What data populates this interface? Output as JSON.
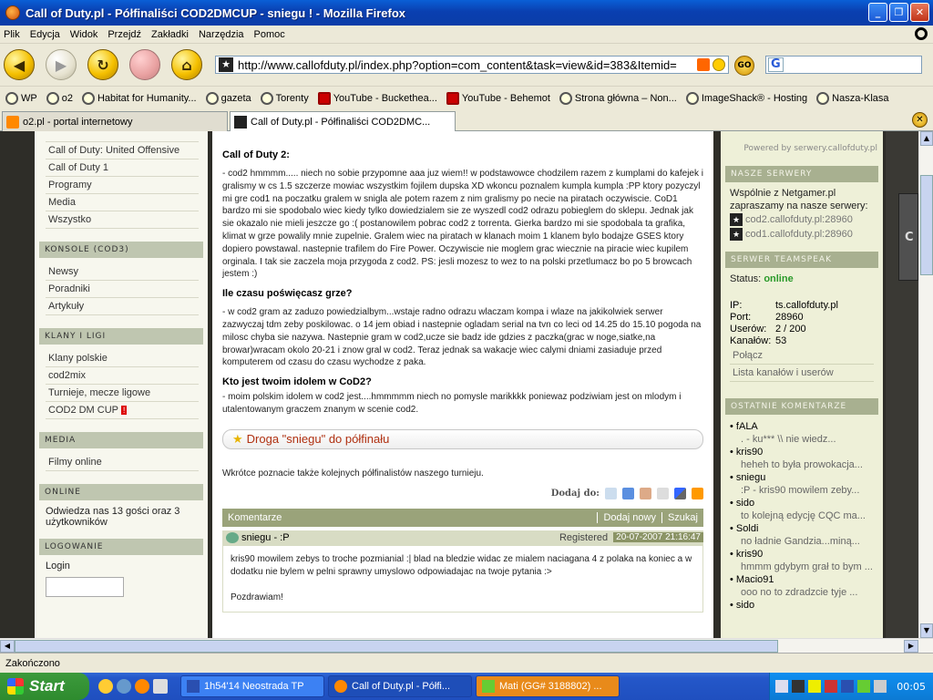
{
  "window": {
    "title": "Call of Duty.pl - Półfinaliści COD2DMCUP - sniegu ! - Mozilla Firefox"
  },
  "menu": [
    "Plik",
    "Edycja",
    "Widok",
    "Przejdź",
    "Zakładki",
    "Narzędzia",
    "Pomoc"
  ],
  "url": "http://www.callofduty.pl/index.php?option=com_content&task=view&id=383&Itemid=",
  "search_prefix": "G",
  "bookmarks": [
    "WP",
    "o2",
    "Habitat for Humanity...",
    "gazeta",
    "Torenty",
    "YouTube - Bucketheа...",
    "YouTube - Behemot",
    "Strona główna – Non...",
    "ImageShack® - Hosting",
    "Nasza-Klasa"
  ],
  "tabs": [
    {
      "label": "o2.pl - portal internetowy",
      "active": false
    },
    {
      "label": "Call of Duty.pl - Półfinaliści COD2DMC...",
      "active": true
    }
  ],
  "status": "Zakończono",
  "taskbar": {
    "start": "Start",
    "tasks": [
      "1h54'14 Neostrada TP",
      "Call of Duty.pl - Półfi...",
      "Mati (GG# 3188802) ..."
    ],
    "clock": "00:05"
  },
  "left": {
    "links_top": [
      "Call of Duty: United Offensive",
      "Call of Duty 1",
      "Programy",
      "Media",
      "Wszystko"
    ],
    "konsole": {
      "title": "KONSOLE (COD3)",
      "items": [
        "Newsy",
        "Poradniki",
        "Artykuły"
      ]
    },
    "klany": {
      "title": "KLANY I LIGI",
      "items": [
        "Klany polskie",
        "cod2mix",
        "Turnieje, mecze ligowe",
        "COD2 DM CUP"
      ]
    },
    "media": {
      "title": "MEDIA",
      "items": [
        "Filmy online"
      ]
    },
    "online": {
      "title": "ONLINE",
      "text": "Odwiedza nas 13 gości oraz 3 użytkowników"
    },
    "login": {
      "title": "LOGOWANIE",
      "label": "Login"
    }
  },
  "article": {
    "h1": "Call of Duty 2:",
    "p1": "- cod2 hmmmm..... niech no sobie przypomne  aaa juz wiem!! w podstawowce chodzilem razem z kumplami do kafejek i gralismy w cs 1.5 szczerze mowiac wszystkim fojilem dupska XD wkoncu poznalem kumpla kumpla :PP ktory pozyczyl mi gre cod1 na poczatku gralem w snigla ale potem razem z nim gralismy po necie na piratach oczywiscie. CoD1 bardzo mi sie spodobalo wiec kiedy tylko dowiedzialem sie ze wyszedl cod2 odrazu pobieglem do sklepu. Jednak jak sie okazalo nie mieli jeszcze go :( postanowilem pobrac cod2 z torrenta. Gierka bardzo mi sie spodobala ta grafika, klimat w grze powalily mnie zupelnie. Gralem wiec na piratach w klanach moim 1 klanem bylo bodajze GSES ktory dopiero powstawal. nastepnie trafilem do Fire Power. Oczywiscie nie moglem grac wiecznie na piracie wiec kupilem orginala. I tak sie zaczela moja przygoda z cod2.    PS: jesli mozesz to wez to na polski przetlumacz bo po 5 browcach jestem :)",
    "h2": "Ile czasu poświęcasz grze?",
    "p2": "- w cod2 gram az zaduzo powiedzialbym...wstaje radno odrazu wlaczam kompa i wlaze na jakikolwiek serwer zazwyczaj tdm zeby poskilowac. o 14 jem obiad i nastepnie ogladam serial na tvn co leci od 14.25 do 15.10 pogoda na milosc chyba sie nazywa. Nastepnie gram w cod2,ucze sie badz ide gdzies z paczka(grac w noge,siatke,na browar)wracam okolo 20-21 i znow gral w cod2. Teraz jednak sa wakacje wiec calymi dniami zasiaduje przed komputerem od czasu do czasu wychodze z paka.",
    "h3": "Kto jest twoim idolem w CoD2?",
    "p3": "- moim polskim idolem w cod2 jest....hmmmmm niech no pomysle  marikkkk poniewaz podziwiam jest on mlodym i utalentowanym graczem znanym w scenie cod2.",
    "banner": "Droga \"sniegu\" do półfinału",
    "p4": "Wkrótce poznacie także kolejnych półfinalistów naszego turnieju.",
    "dodaj": "Dodaj do:",
    "comments": {
      "title": "Komentarze",
      "add": "Dodaj nowy",
      "search": "Szukaj",
      "user": "sniegu - :P",
      "registered": "Registered",
      "date": "20-07-2007 21:16:47",
      "body": "kris90 mowilem zebys to troche pozmianial :| blad na bledzie widac ze mialem naciagana 4 z polaka na koniec a w dodatku nie bylem w pelni sprawny umyslowo odpowiadajac na twoje pytania :>",
      "sign": "Pozdrawiam!"
    }
  },
  "right": {
    "powered": "Powered by serwery.callofduty.pl",
    "serwery": {
      "title": "NASZE SERWERY",
      "intro1": "Wspólnie z Netgamer.pl",
      "intro2": "zapraszamy na nasze serwery:",
      "s1": "cod2.callofduty.pl:28960",
      "s2": "cod1.callofduty.pl:28960"
    },
    "ts": {
      "title": "SERWER TEAMSPEAK",
      "status_label": "Status:",
      "status": "online",
      "ip_l": "IP:",
      "ip": "ts.callofduty.pl",
      "port_l": "Port:",
      "port": "28960",
      "users_l": "Userów:",
      "users": "2 / 200",
      "chan_l": "Kanałów:",
      "chan": "53",
      "connect": "Połącz",
      "list": "Lista kanałów i userów"
    },
    "komentarze": {
      "title": "OSTATNIE KOMENTARZE",
      "items": [
        {
          "n": "fALA",
          "e": ". - ku*** \\\\ nie wiedz..."
        },
        {
          "n": "kris90",
          "e": "heheh to była prowokacja..."
        },
        {
          "n": "sniegu",
          "e": ":P - kris90 mowilem zeby..."
        },
        {
          "n": "sido",
          "e": "to kolejną edycję CQC ma..."
        },
        {
          "n": "Soldi",
          "e": "no ładnie Gandzia...miną..."
        },
        {
          "n": "kris90",
          "e": "hmmm gdybym grał to bym ..."
        },
        {
          "n": "Macio91",
          "e": "ooo no to zdradzcie tyje ..."
        },
        {
          "n": "sido",
          "e": ""
        }
      ]
    }
  }
}
